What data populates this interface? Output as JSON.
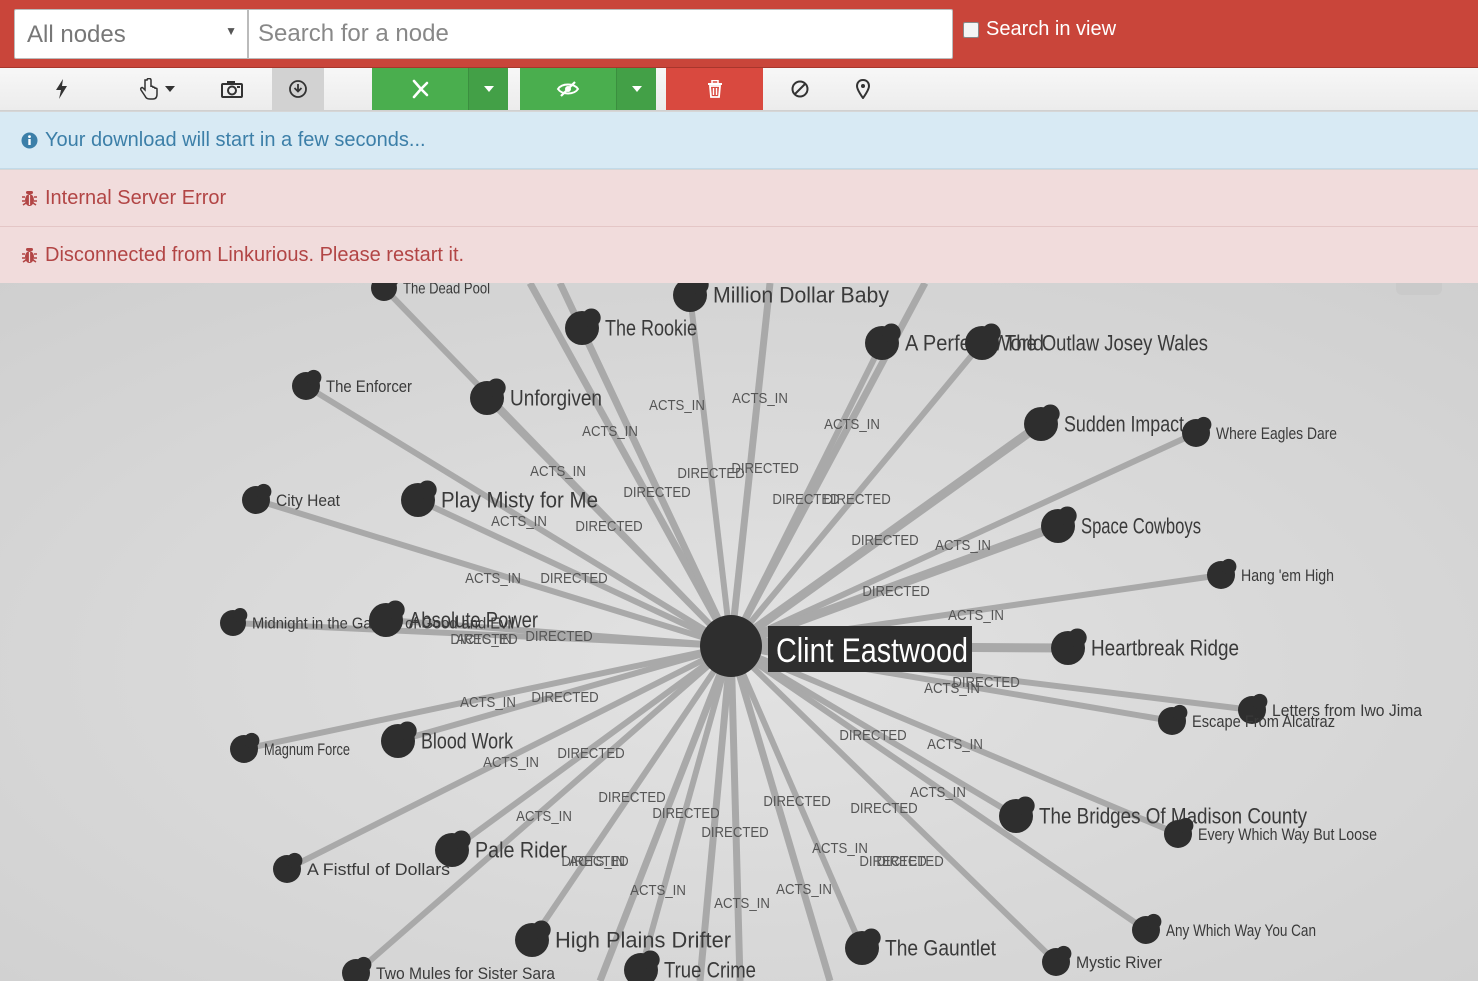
{
  "search_bar": {
    "filter_value": "All nodes",
    "search_placeholder": "Search for a node",
    "search_in_view_label": "Search in view",
    "search_in_view_checked": false
  },
  "toolbar": {
    "buttons": [
      {
        "name": "layout-button",
        "icon": "bolt-icon"
      },
      {
        "name": "select-mode-button",
        "icon": "hand-pointer-icon"
      },
      {
        "name": "screenshot-button",
        "icon": "camera-icon"
      },
      {
        "name": "download-button",
        "icon": "download-circle-icon",
        "active": true
      },
      {
        "name": "expand-button",
        "icon": "expand-arrows-icon",
        "color": "#4aae4e"
      },
      {
        "name": "visibility-button",
        "icon": "eye-slash-icon",
        "color": "#4aae4e"
      },
      {
        "name": "delete-button",
        "icon": "trash-icon",
        "color": "#d9493f"
      },
      {
        "name": "clear-button",
        "icon": "ban-icon"
      },
      {
        "name": "locate-button",
        "icon": "map-marker-icon"
      }
    ]
  },
  "alerts": [
    {
      "type": "info",
      "icon": "info-circle-icon",
      "text": "Your download will start in a few seconds...",
      "color": "#3c7fa8"
    },
    {
      "type": "error",
      "icon": "bug-icon",
      "text": "Internal Server Error",
      "color": "#b24545"
    },
    {
      "type": "error",
      "icon": "bug-icon",
      "text": "Disconnected from Linkurious. Please restart it.",
      "color": "#b24545"
    }
  ],
  "graph": {
    "center": {
      "label": "Clint Eastwood"
    },
    "nodes": [
      {
        "label": "The Dead Pool"
      },
      {
        "label": "Million Dollar Baby"
      },
      {
        "label": "Blood Work"
      },
      {
        "label": "The Rookie"
      },
      {
        "label": "A Perfect World"
      },
      {
        "label": "The Outlaw Josey Wales"
      },
      {
        "label": "The Enforcer"
      },
      {
        "label": "Unforgiven"
      },
      {
        "label": "Sudden Impact"
      },
      {
        "label": "Where Eagles Dare"
      },
      {
        "label": "City Heat"
      },
      {
        "label": "Play Misty for Me"
      },
      {
        "label": "Space Cowboys"
      },
      {
        "label": "Hang 'em High"
      },
      {
        "label": "Midnight in the Garden of Good and Evil"
      },
      {
        "label": "Absolute Power"
      },
      {
        "label": "Heartbreak Ridge"
      },
      {
        "label": "Letters from Iwo Jima"
      },
      {
        "label": "Escape From Alcatraz"
      },
      {
        "label": "Magnum Force"
      },
      {
        "label": "The Bridges Of Madison County"
      },
      {
        "label": "Every Which Way But Loose"
      },
      {
        "label": "A Fistful of Dollars"
      },
      {
        "label": "Pale Rider"
      },
      {
        "label": "Any Which Way You Can"
      },
      {
        "label": "High Plains Drifter"
      },
      {
        "label": "The Gauntlet"
      },
      {
        "label": "Mystic River"
      },
      {
        "label": "Two Mules for Sister Sara"
      },
      {
        "label": "True Crime"
      }
    ],
    "edge_labels": [
      "ACTS_IN",
      "ACTS_IN",
      "ACTS_IN",
      "ACTS_IN",
      "ACTS_IN",
      "ACTS_IN",
      "ACTS_IN",
      "ACTS_IN",
      "ACTS_IN",
      "ACTS_IN",
      "ACTS_IN",
      "ACTS_IN",
      "ACTS_IN",
      "ACTS_IN",
      "ACTS_IN",
      "ACTS_IN",
      "ACTS_IN",
      "ACTS_IN",
      "ACTS_IN",
      "ACTS_IN",
      "ACTS_IN",
      "DIRECTED",
      "DIRECTED",
      "DIRECTED",
      "DIRECTED",
      "DIRECTED",
      "DIRECTED",
      "DIRECTED",
      "DIRECTED",
      "DIRECTED",
      "DIRECTED",
      "DIRECTED",
      "DIRECTED",
      "DIRECTED",
      "DIRECTED",
      "DIRECTED",
      "DIRECTED",
      "DIRECTED",
      "DIRECTED",
      "DIRECTED",
      "DIRECTED",
      "DIRECTED",
      "DIRECTED",
      "DIRECTED"
    ]
  }
}
